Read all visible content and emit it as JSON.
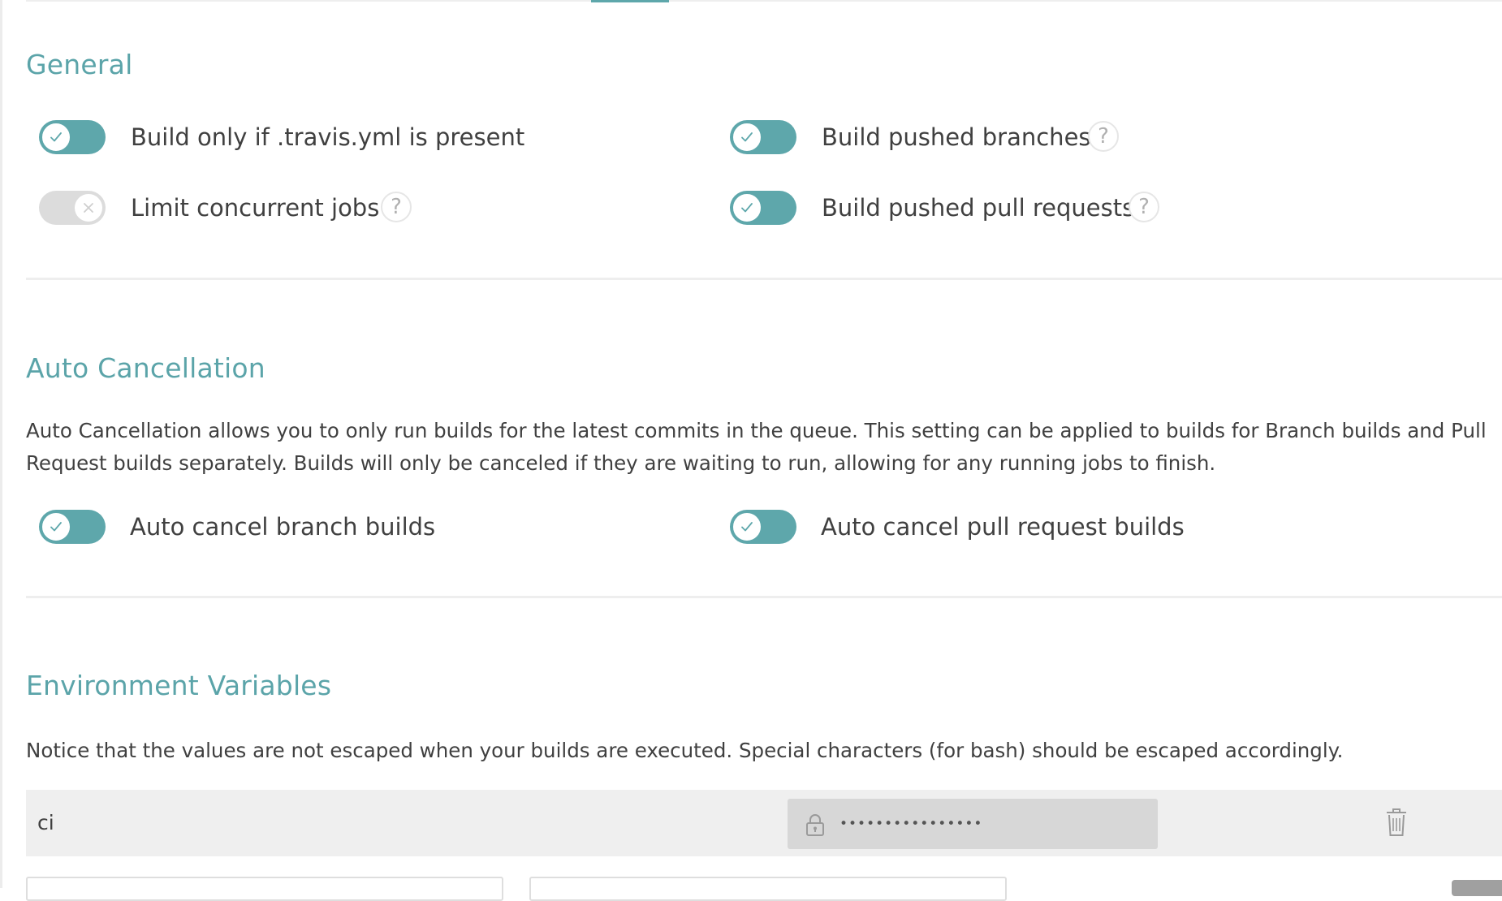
{
  "general": {
    "title": "General",
    "options": [
      {
        "label": "Build only if .travis.yml is present",
        "enabled": true,
        "has_help": false
      },
      {
        "label": "Build pushed branches",
        "enabled": true,
        "has_help": true
      },
      {
        "label": "Limit concurrent jobs",
        "enabled": false,
        "has_help": true
      },
      {
        "label": "Build pushed pull requests",
        "enabled": true,
        "has_help": true
      }
    ]
  },
  "auto_cancellation": {
    "title": "Auto Cancellation",
    "description": "Auto Cancellation allows you to only run builds for the latest commits in the queue. This setting can be applied to builds for Branch builds and Pull Request builds separately. Builds will only be canceled if they are waiting to run, allowing for any running jobs to finish.",
    "options": [
      {
        "label": "Auto cancel branch builds",
        "enabled": true
      },
      {
        "label": "Auto cancel pull request builds",
        "enabled": true
      }
    ]
  },
  "env_vars": {
    "title": "Environment Variables",
    "notice": "Notice that the values are not escaped when your builds are executed. Special characters (for bash) should be escaped accordingly.",
    "rows": [
      {
        "name": "ci",
        "value_masked": "••••••••••••••••"
      }
    ]
  },
  "help_glyph": "?",
  "colors": {
    "accent": "#5ea7ab",
    "heading": "#5ba4a9",
    "toggle_off": "#dcdcdc"
  },
  "icons": {
    "check": "check-icon",
    "cross": "cross-icon",
    "help": "question-icon",
    "lock": "lock-icon",
    "trash": "trash-icon"
  }
}
